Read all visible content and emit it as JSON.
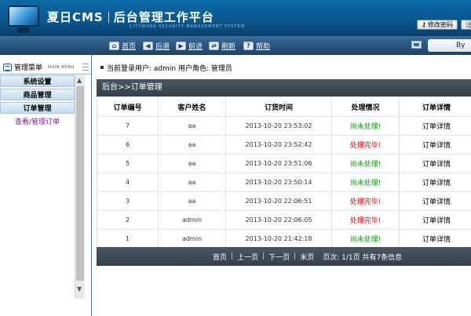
{
  "header": {
    "app_name": "夏日CMS",
    "app_title": "后台管理工作平台",
    "subtitle": "CITYWORK SECURITY MANAGEMENT SYSTEM",
    "change_password": "修改密码",
    "logout_initial": "注"
  },
  "nav": {
    "items": [
      {
        "label": "首页",
        "icon": "home-icon"
      },
      {
        "label": "后退",
        "icon": "arrow-left-icon"
      },
      {
        "label": "前进",
        "icon": "arrow-right-icon"
      },
      {
        "label": "刷新",
        "icon": "refresh-icon"
      },
      {
        "label": "帮助",
        "icon": "help-icon"
      }
    ],
    "right_text": "By"
  },
  "sidebar": {
    "title": "管理菜单",
    "title_en": "MAIN MENU",
    "categories": [
      "系统设置",
      "商品管理",
      "订单管理"
    ],
    "sub_item": "查看/管理订单"
  },
  "user_bar": {
    "text": "当前登录用户: admin  用户角色: 管理员"
  },
  "panel": {
    "title": "后台>>订单管理",
    "columns": [
      "订单编号",
      "客户姓名",
      "订货时间",
      "处理情况",
      "订单详情"
    ],
    "rows": [
      {
        "id": "7",
        "customer": "aa",
        "time": "2013-10-20 23:53:02",
        "status": "尚未处理!",
        "status_type": "pending",
        "detail": "订单详情"
      },
      {
        "id": "6",
        "customer": "aa",
        "time": "2013-10-20 23:52:42",
        "status": "处理完毕!",
        "status_type": "done",
        "detail": "订单详情"
      },
      {
        "id": "5",
        "customer": "aa",
        "time": "2013-10-20 23:51:06",
        "status": "尚未处理!",
        "status_type": "pending",
        "detail": "订单详情"
      },
      {
        "id": "4",
        "customer": "aa",
        "time": "2013-10-20 23:50:14",
        "status": "尚未处理!",
        "status_type": "pending",
        "detail": "订单详情"
      },
      {
        "id": "3",
        "customer": "aa",
        "time": "2013-10-20 22:06:51",
        "status": "处理完毕!",
        "status_type": "done",
        "detail": "订单详情"
      },
      {
        "id": "2",
        "customer": "admin",
        "time": "2013-10-20 22:06:05",
        "status": "处理完毕!",
        "status_type": "done",
        "detail": "订单详情"
      },
      {
        "id": "1",
        "customer": "admin",
        "time": "2013-10-20 21:42:18",
        "status": "尚未处理!",
        "status_type": "pending",
        "detail": "订单详情"
      }
    ],
    "pager": {
      "first": "首页",
      "prev": "上一页",
      "next": "下一页",
      "last": "末页",
      "info": "页次: 1/1页 共有7条信息"
    }
  },
  "colors": {
    "pending": "#0aa50a",
    "done": "#e00000",
    "banner": "#0a568d",
    "panel_header": "#3f4a54"
  }
}
